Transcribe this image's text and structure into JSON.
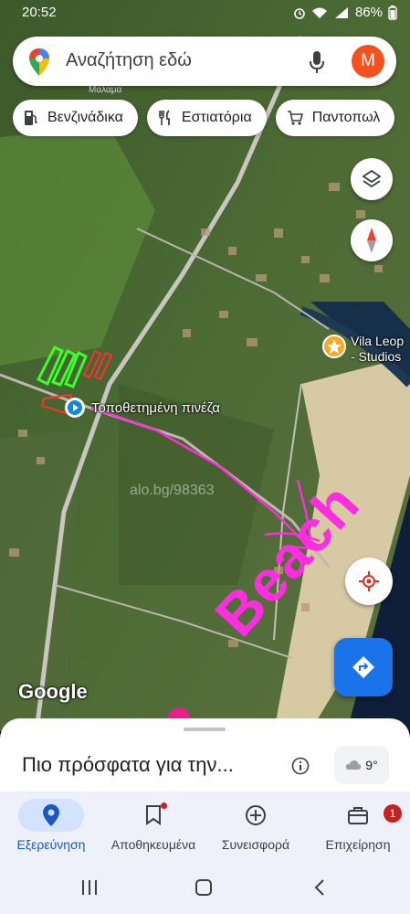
{
  "status_bar": {
    "time": "20:52",
    "battery": "86%"
  },
  "search": {
    "placeholder": "Αναζήτηση εδώ",
    "avatar_letter": "M"
  },
  "chips": [
    {
      "label": "Βενζινάδικα",
      "icon": "gas-station-icon"
    },
    {
      "label": "Εστιατόρια",
      "icon": "restaurant-icon"
    },
    {
      "label": "Παντοπωλ",
      "icon": "cart-icon"
    }
  ],
  "map": {
    "place_label_small": "Μαλαμα",
    "pin_label": "Τοποθετημένη πινέζα",
    "poi_label_line1": "Vila Leop",
    "poi_label_line2": "- Studios",
    "annotation": "Beach",
    "watermark": "alo.bg/98363",
    "attribution": "Google"
  },
  "sheet": {
    "title": "Πιο πρόσφατα για την...",
    "temperature": "9°"
  },
  "nav": {
    "items": [
      {
        "label": "Εξερεύνηση",
        "icon": "explore-pin-icon",
        "active": true
      },
      {
        "label": "Αποθηκευμένα",
        "icon": "bookmark-icon"
      },
      {
        "label": "Συνεισφορά",
        "icon": "add-circle-icon"
      },
      {
        "label": "Επιχείρηση",
        "icon": "store-icon",
        "badge": "1"
      }
    ]
  },
  "colors": {
    "accent": "#1a73e8",
    "annotation": "#ff2de0",
    "avatar": "#f4511e"
  }
}
